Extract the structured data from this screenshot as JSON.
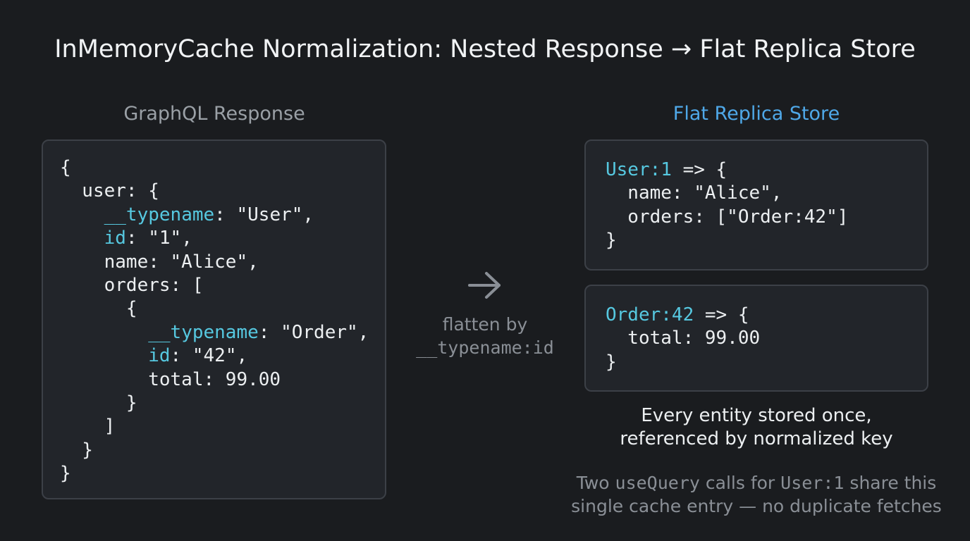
{
  "title": "InMemoryCache Normalization: Nested Response → Flat Replica Store",
  "left_heading": "GraphQL Response",
  "right_heading": "Flat Replica Store",
  "colors": {
    "background": "#1a1c1f",
    "panel": "#22252a",
    "panel_border": "#3c4047",
    "key_highlight": "#56c8e0",
    "heading_accent": "#4fa8e8",
    "muted": "#8a8f96"
  },
  "response_code": [
    [
      {
        "t": "{"
      }
    ],
    [
      {
        "t": "  user: {"
      }
    ],
    [
      {
        "t": "    "
      },
      {
        "t": "__typename",
        "k": true
      },
      {
        "t": ": \"User\","
      }
    ],
    [
      {
        "t": "    "
      },
      {
        "t": "id",
        "k": true
      },
      {
        "t": ": \"1\","
      }
    ],
    [
      {
        "t": "    name: \"Alice\","
      }
    ],
    [
      {
        "t": "    orders: ["
      }
    ],
    [
      {
        "t": "      {"
      }
    ],
    [
      {
        "t": "        "
      },
      {
        "t": "__typename",
        "k": true
      },
      {
        "t": ": \"Order\","
      }
    ],
    [
      {
        "t": "        "
      },
      {
        "t": "id",
        "k": true
      },
      {
        "t": ": \"42\","
      }
    ],
    [
      {
        "t": "        total: 99.00"
      }
    ],
    [
      {
        "t": "      }"
      }
    ],
    [
      {
        "t": "    ]"
      }
    ],
    [
      {
        "t": "  }"
      }
    ],
    [
      {
        "t": "}"
      }
    ]
  ],
  "user_entry_code": [
    [
      {
        "t": "User:1",
        "k": true
      },
      {
        "t": " => {"
      }
    ],
    [
      {
        "t": "  name: \"Alice\","
      }
    ],
    [
      {
        "t": "  orders: [\"Order:42\"]"
      }
    ],
    [
      {
        "t": "}"
      }
    ]
  ],
  "order_entry_code": [
    [
      {
        "t": "Order:42",
        "k": true
      },
      {
        "t": " => {"
      }
    ],
    [
      {
        "t": "  total: 99.00"
      }
    ],
    [
      {
        "t": "}"
      }
    ]
  ],
  "arrow_icon": "right-arrow-icon",
  "flatten_label": {
    "line1": "flatten by",
    "line2": "__typename:id"
  },
  "note": {
    "line1": "Every entity stored once,",
    "line2": "referenced by normalized key"
  },
  "subnote": {
    "line1_a": "Two ",
    "line1_b": "useQuery",
    "line1_c": " calls for ",
    "line1_d": "User:1",
    "line1_e": " share this",
    "line2": "single cache entry — no duplicate fetches"
  }
}
